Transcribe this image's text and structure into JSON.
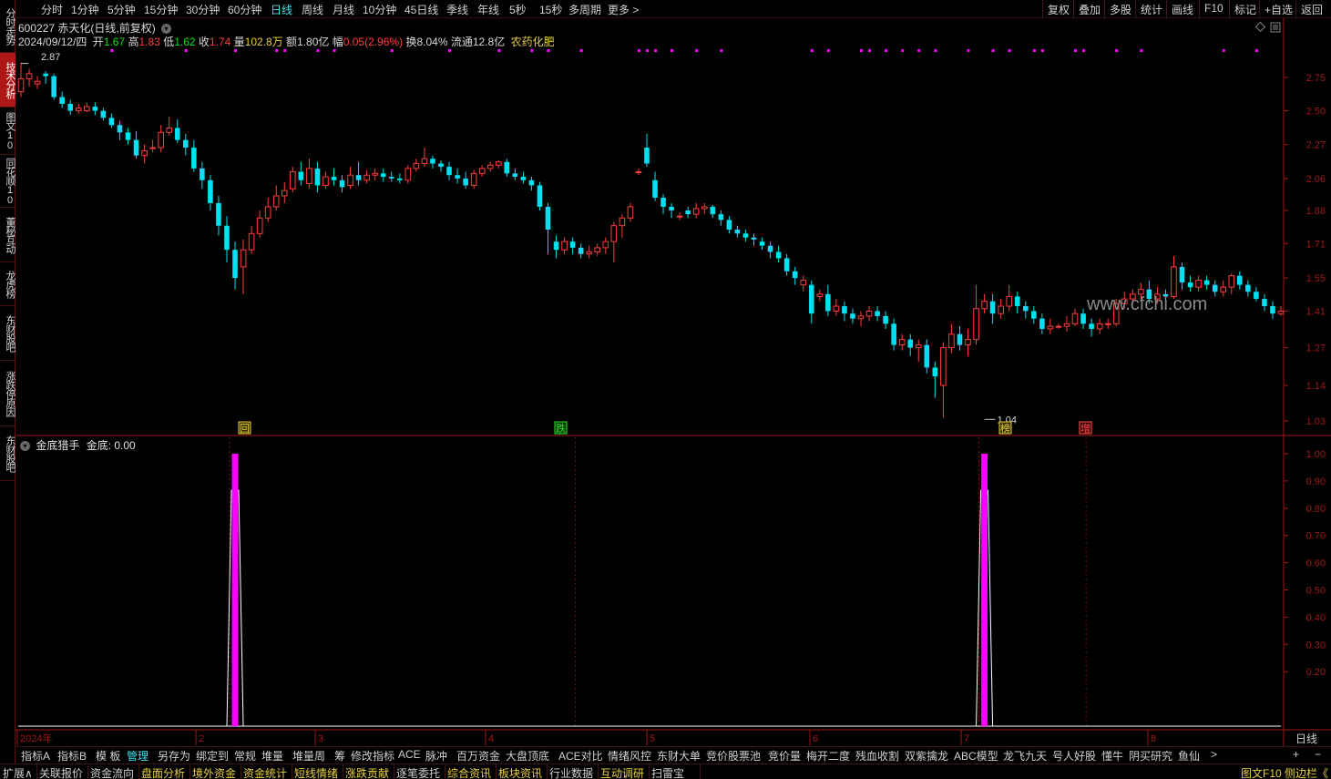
{
  "sidebar": {
    "tabs": [
      {
        "label": "分时走势",
        "active": false
      },
      {
        "label": "技术分析",
        "active": true
      },
      {
        "label": "图文10",
        "active": false
      },
      {
        "label": "同花顺10",
        "active": false
      },
      {
        "label": "董秘互动",
        "active": false
      },
      {
        "label": "龙虎榜",
        "active": false
      },
      {
        "label": "东财股吧",
        "active": false
      },
      {
        "label": "涨跌停原因",
        "active": false
      },
      {
        "label": "东财股吧",
        "active": false
      }
    ]
  },
  "toolbar": {
    "periods": [
      "分时",
      "1分钟",
      "5分钟",
      "15分钟",
      "30分钟",
      "60分钟",
      "日线",
      "周线",
      "月线",
      "10分钟",
      "45日线",
      "季线",
      "年线",
      "5秒",
      "15秒",
      "多周期",
      "更多 >"
    ],
    "active_period": "日线",
    "right": [
      "复权",
      "叠加",
      "多股",
      "统计",
      "画线",
      "F10",
      "标记",
      "+自选",
      "返回"
    ]
  },
  "stock": {
    "code_name": "600227 赤天化(日线,前复权)",
    "date": "2024/09/12/四",
    "open_label": "开",
    "open": "1.67",
    "high_label": "高",
    "high": "1.83",
    "low_label": "低",
    "low": "1.62",
    "close_label": "收",
    "close": "1.74",
    "volume_label": "量",
    "volume": "102.8万",
    "amount_label": "额",
    "amount": "1.80亿",
    "change_label": "幅",
    "change": "0.05(2.96%)",
    "turnover_label": "换",
    "turnover": "8.04%",
    "float_label": "流通",
    "float": "12.8亿",
    "industry": "农药化肥"
  },
  "price_axis": [
    "2.75",
    "2.50",
    "2.27",
    "2.06",
    "1.88",
    "1.71",
    "1.55",
    "1.41",
    "1.27",
    "1.14",
    "1.03"
  ],
  "annotations": {
    "high_label": "2.87",
    "low_label": "1.04",
    "watermark": "www.cfchi.com",
    "markers": [
      "回",
      "跌",
      "榜",
      "增"
    ]
  },
  "indicator": {
    "title": "金底猎手",
    "value_label": "金底: 0.00",
    "axis": [
      "1.00",
      "0.90",
      "0.80",
      "0.70",
      "0.60",
      "0.50",
      "0.40",
      "0.30",
      "0.20"
    ]
  },
  "date_axis": [
    "2024年",
    "2",
    "3",
    "4",
    "5",
    "6",
    "7",
    "8"
  ],
  "date_axis_right": "日线",
  "bottom_tabs": [
    "指标A",
    "指标B",
    "模 板",
    "管理",
    "另存为",
    "绑定到",
    "常规",
    "堆量",
    "堆量周",
    "筹",
    "修改指标",
    "ACE",
    "脉冲",
    "百万资金",
    "大盘顶底",
    "ACE对比",
    "情绪风控",
    "东财大单",
    "竞价股票池",
    "竞价量",
    "梅开二度",
    "残血收割",
    "双紫擒龙",
    "ABC模型",
    "龙飞九天",
    "号人好股",
    "懂牛",
    "阴买研究",
    "鱼仙",
    ">"
  ],
  "bottom_tabs_active": "管理",
  "bottom_right": [
    "+",
    "−"
  ],
  "status_bar": [
    "扩展∧",
    "关联报价",
    "资金流向",
    "盘面分析",
    "境外资金",
    "资金统计",
    "短线情绪",
    "涨跌贡献",
    "逐笔委托",
    "综合资讯",
    "板块资讯",
    "行业数据",
    "互动调研",
    "扫雷宝"
  ],
  "status_yellow": [
    "盘面分析",
    "境外资金",
    "资金统计",
    "短线情绪",
    "涨跌贡献",
    "综合资讯",
    "板块资讯",
    "互动调研"
  ],
  "status_right": "图文F10 侧边栏《",
  "colors": {
    "up": "#ff3c3c",
    "down": "#00e0f0",
    "pink": "#ff00ff",
    "axis": "#a01818"
  },
  "chart_data": {
    "type": "candlestick",
    "price_range": [
      1.03,
      2.87
    ],
    "candles": [
      [
        2.64,
        2.74,
        2.87,
        2.6
      ],
      [
        2.74,
        2.78,
        2.82,
        2.68
      ],
      [
        2.7,
        2.72,
        2.76,
        2.66
      ],
      [
        2.78,
        2.76,
        2.8,
        2.7
      ],
      [
        2.76,
        2.6,
        2.78,
        2.58
      ],
      [
        2.6,
        2.55,
        2.64,
        2.52
      ],
      [
        2.55,
        2.5,
        2.58,
        2.47
      ],
      [
        2.5,
        2.52,
        2.55,
        2.48
      ],
      [
        2.5,
        2.53,
        2.56,
        2.49
      ],
      [
        2.53,
        2.5,
        2.56,
        2.47
      ],
      [
        2.5,
        2.45,
        2.52,
        2.43
      ],
      [
        2.45,
        2.4,
        2.48,
        2.38
      ],
      [
        2.4,
        2.35,
        2.43,
        2.3
      ],
      [
        2.35,
        2.3,
        2.38,
        2.27
      ],
      [
        2.3,
        2.2,
        2.36,
        2.18
      ],
      [
        2.2,
        2.23,
        2.27,
        2.15
      ],
      [
        2.25,
        2.25,
        2.3,
        2.22
      ],
      [
        2.25,
        2.35,
        2.4,
        2.22
      ],
      [
        2.35,
        2.38,
        2.46,
        2.33
      ],
      [
        2.38,
        2.3,
        2.44,
        2.28
      ],
      [
        2.3,
        2.25,
        2.34,
        2.2
      ],
      [
        2.25,
        2.12,
        2.3,
        2.1
      ],
      [
        2.12,
        2.05,
        2.16,
        2.0
      ],
      [
        2.05,
        1.92,
        2.08,
        1.88
      ],
      [
        1.92,
        1.8,
        1.96,
        1.75
      ],
      [
        1.8,
        1.68,
        1.85,
        1.62
      ],
      [
        1.68,
        1.55,
        1.72,
        1.5
      ],
      [
        1.6,
        1.68,
        1.73,
        1.48
      ],
      [
        1.68,
        1.76,
        1.8,
        1.66
      ],
      [
        1.76,
        1.84,
        1.88,
        1.74
      ],
      [
        1.84,
        1.9,
        1.95,
        1.82
      ],
      [
        1.9,
        1.96,
        2.02,
        1.88
      ],
      [
        1.96,
        1.99,
        2.04,
        1.92
      ],
      [
        2.0,
        2.1,
        2.13,
        1.98
      ],
      [
        2.1,
        2.05,
        2.16,
        2.02
      ],
      [
        2.03,
        2.12,
        2.18,
        2.0
      ],
      [
        2.12,
        2.02,
        2.16,
        1.98
      ],
      [
        2.02,
        2.07,
        2.1,
        2.0
      ],
      [
        2.07,
        2.05,
        2.12,
        2.02
      ],
      [
        2.05,
        2.01,
        2.08,
        1.98
      ],
      [
        2.02,
        2.08,
        2.13,
        2.0
      ],
      [
        2.08,
        2.05,
        2.16,
        2.02
      ],
      [
        2.05,
        2.08,
        2.11,
        2.03
      ],
      [
        2.08,
        2.09,
        2.12,
        2.05
      ],
      [
        2.09,
        2.07,
        2.12,
        2.04
      ],
      [
        2.07,
        2.06,
        2.1,
        2.04
      ],
      [
        2.06,
        2.05,
        2.09,
        2.03
      ],
      [
        2.05,
        2.12,
        2.14,
        2.03
      ],
      [
        2.12,
        2.15,
        2.18,
        2.1
      ],
      [
        2.15,
        2.18,
        2.25,
        2.13
      ],
      [
        2.18,
        2.15,
        2.2,
        2.12
      ],
      [
        2.15,
        2.13,
        2.17,
        2.1
      ],
      [
        2.13,
        2.08,
        2.16,
        2.05
      ],
      [
        2.08,
        2.06,
        2.12,
        2.03
      ],
      [
        2.06,
        2.02,
        2.1,
        2.0
      ],
      [
        2.02,
        2.09,
        2.11,
        2.0
      ],
      [
        2.09,
        2.12,
        2.14,
        2.07
      ],
      [
        2.12,
        2.14,
        2.16,
        2.1
      ],
      [
        2.14,
        2.16,
        2.17,
        2.12
      ],
      [
        2.16,
        2.09,
        2.18,
        2.07
      ],
      [
        2.09,
        2.07,
        2.12,
        2.05
      ],
      [
        2.07,
        2.05,
        2.1,
        2.03
      ],
      [
        2.05,
        2.02,
        2.07,
        1.99
      ],
      [
        2.02,
        1.9,
        2.04,
        1.88
      ],
      [
        1.9,
        1.78,
        1.92,
        1.66
      ],
      [
        1.72,
        1.68,
        1.75,
        1.64
      ],
      [
        1.68,
        1.72,
        1.74,
        1.66
      ],
      [
        1.72,
        1.69,
        1.74,
        1.66
      ],
      [
        1.69,
        1.66,
        1.71,
        1.64
      ],
      [
        1.66,
        1.67,
        1.7,
        1.64
      ],
      [
        1.67,
        1.69,
        1.71,
        1.65
      ],
      [
        1.69,
        1.72,
        1.74,
        1.66
      ],
      [
        1.72,
        1.8,
        1.82,
        1.62
      ],
      [
        1.8,
        1.84,
        1.86,
        1.74
      ],
      [
        1.84,
        1.9,
        1.92,
        1.82
      ],
      [
        2.1,
        2.1,
        2.12,
        2.08
      ],
      [
        2.25,
        2.15,
        2.34,
        2.13
      ],
      [
        2.05,
        1.95,
        2.1,
        1.93
      ],
      [
        1.95,
        1.9,
        1.97,
        1.86
      ],
      [
        1.9,
        1.88,
        1.92,
        1.84
      ],
      [
        1.85,
        1.85,
        1.87,
        1.83
      ],
      [
        1.88,
        1.86,
        1.9,
        1.84
      ],
      [
        1.86,
        1.89,
        1.92,
        1.84
      ],
      [
        1.89,
        1.9,
        1.92,
        1.86
      ],
      [
        1.9,
        1.86,
        1.91,
        1.84
      ],
      [
        1.86,
        1.83,
        1.88,
        1.8
      ],
      [
        1.83,
        1.78,
        1.85,
        1.76
      ],
      [
        1.78,
        1.76,
        1.8,
        1.74
      ],
      [
        1.76,
        1.74,
        1.78,
        1.72
      ],
      [
        1.74,
        1.73,
        1.76,
        1.7
      ],
      [
        1.72,
        1.7,
        1.74,
        1.68
      ],
      [
        1.7,
        1.67,
        1.72,
        1.64
      ],
      [
        1.67,
        1.64,
        1.7,
        1.62
      ],
      [
        1.64,
        1.58,
        1.66,
        1.56
      ],
      [
        1.58,
        1.55,
        1.6,
        1.52
      ],
      [
        1.52,
        1.54,
        1.56,
        1.49
      ],
      [
        1.52,
        1.4,
        1.54,
        1.36
      ],
      [
        1.47,
        1.48,
        1.5,
        1.45
      ],
      [
        1.48,
        1.41,
        1.52,
        1.39
      ],
      [
        1.41,
        1.43,
        1.46,
        1.39
      ],
      [
        1.43,
        1.4,
        1.45,
        1.37
      ],
      [
        1.4,
        1.38,
        1.42,
        1.36
      ],
      [
        1.38,
        1.39,
        1.41,
        1.35
      ],
      [
        1.39,
        1.41,
        1.43,
        1.37
      ],
      [
        1.41,
        1.39,
        1.43,
        1.37
      ],
      [
        1.39,
        1.36,
        1.41,
        1.34
      ],
      [
        1.36,
        1.28,
        1.38,
        1.26
      ],
      [
        1.28,
        1.3,
        1.32,
        1.26
      ],
      [
        1.3,
        1.27,
        1.32,
        1.24
      ],
      [
        1.27,
        1.28,
        1.3,
        1.22
      ],
      [
        1.28,
        1.2,
        1.3,
        1.18
      ],
      [
        1.2,
        1.17,
        1.22,
        1.1
      ],
      [
        1.14,
        1.27,
        1.29,
        1.04
      ],
      [
        1.27,
        1.32,
        1.36,
        1.25
      ],
      [
        1.32,
        1.28,
        1.35,
        1.26
      ],
      [
        1.28,
        1.3,
        1.34,
        1.24
      ],
      [
        1.3,
        1.42,
        1.52,
        1.28
      ],
      [
        1.42,
        1.45,
        1.48,
        1.4
      ],
      [
        1.45,
        1.4,
        1.48,
        1.36
      ],
      [
        1.4,
        1.43,
        1.46,
        1.38
      ],
      [
        1.43,
        1.47,
        1.52,
        1.41
      ],
      [
        1.47,
        1.43,
        1.49,
        1.4
      ],
      [
        1.43,
        1.41,
        1.45,
        1.38
      ],
      [
        1.41,
        1.38,
        1.43,
        1.36
      ],
      [
        1.38,
        1.34,
        1.4,
        1.32
      ],
      [
        1.34,
        1.35,
        1.38,
        1.32
      ],
      [
        1.35,
        1.35,
        1.36,
        1.34
      ],
      [
        1.35,
        1.36,
        1.39,
        1.33
      ],
      [
        1.36,
        1.4,
        1.42,
        1.35
      ],
      [
        1.4,
        1.36,
        1.42,
        1.34
      ],
      [
        1.36,
        1.34,
        1.38,
        1.31
      ],
      [
        1.34,
        1.36,
        1.38,
        1.32
      ],
      [
        1.36,
        1.36,
        1.38,
        1.34
      ],
      [
        1.36,
        1.44,
        1.46,
        1.35
      ],
      [
        1.44,
        1.46,
        1.49,
        1.42
      ],
      [
        1.46,
        1.48,
        1.5,
        1.44
      ],
      [
        1.48,
        1.5,
        1.53,
        1.46
      ],
      [
        1.5,
        1.46,
        1.54,
        1.44
      ],
      [
        1.46,
        1.48,
        1.51,
        1.44
      ],
      [
        1.48,
        1.47,
        1.5,
        1.45
      ],
      [
        1.47,
        1.6,
        1.65,
        1.46
      ],
      [
        1.6,
        1.53,
        1.62,
        1.5
      ],
      [
        1.53,
        1.51,
        1.56,
        1.49
      ],
      [
        1.51,
        1.54,
        1.56,
        1.49
      ],
      [
        1.54,
        1.52,
        1.56,
        1.5
      ],
      [
        1.52,
        1.49,
        1.54,
        1.47
      ],
      [
        1.49,
        1.51,
        1.54,
        1.47
      ],
      [
        1.51,
        1.56,
        1.57,
        1.48
      ],
      [
        1.56,
        1.52,
        1.58,
        1.5
      ],
      [
        1.52,
        1.49,
        1.54,
        1.47
      ],
      [
        1.49,
        1.46,
        1.51,
        1.45
      ],
      [
        1.46,
        1.43,
        1.48,
        1.41
      ],
      [
        1.43,
        1.4,
        1.45,
        1.38
      ],
      [
        1.4,
        1.41,
        1.43,
        1.39
      ]
    ],
    "indicator_signals": [
      {
        "candle_index": 26,
        "value": 1.0
      },
      {
        "candle_index": 117,
        "value": 1.0
      }
    ],
    "indicator_range": [
      0,
      1
    ]
  }
}
